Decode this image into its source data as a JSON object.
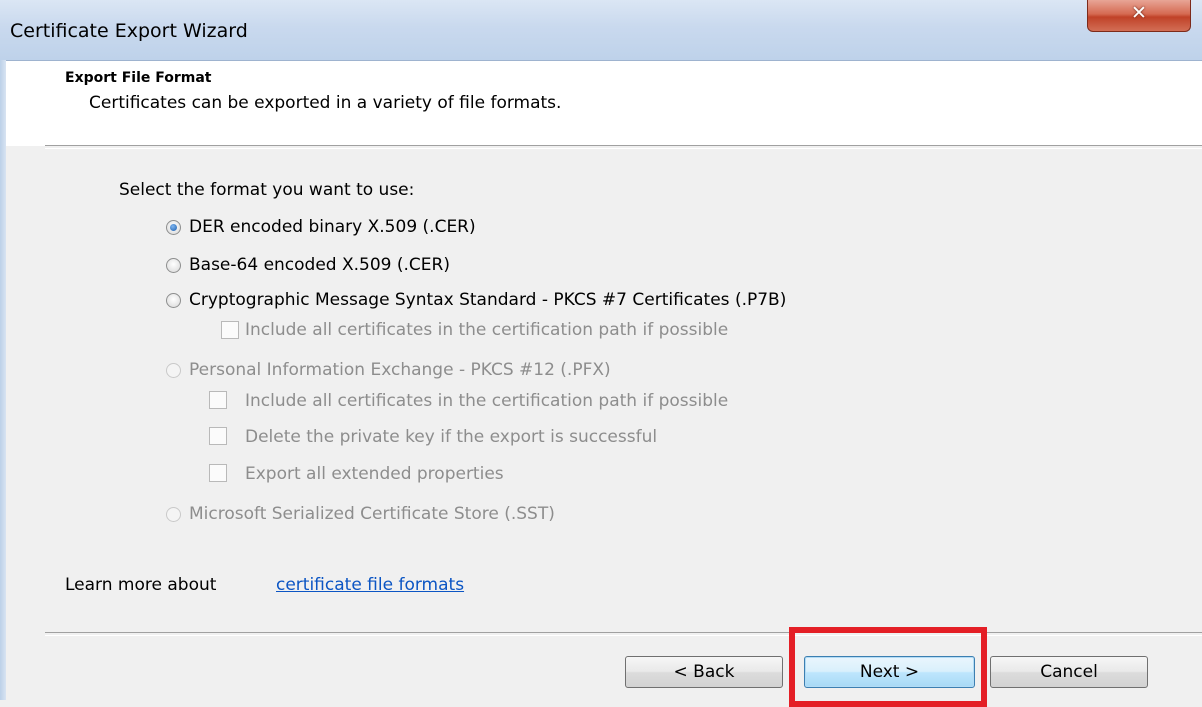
{
  "window": {
    "title": "Certificate Export Wizard",
    "close_label": "✕"
  },
  "header": {
    "title": "Export File Format",
    "description": "Certificates can be exported in a variety of file formats."
  },
  "prompt": "Select the format you want to use:",
  "options": [
    {
      "label": "DER encoded binary X.509 (.CER)",
      "checked": true,
      "enabled": true
    },
    {
      "label": "Base-64 encoded X.509 (.CER)",
      "checked": false,
      "enabled": true
    },
    {
      "label": "Cryptographic Message Syntax Standard - PKCS #7 Certificates (.P7B)",
      "checked": false,
      "enabled": true
    },
    {
      "label": "Personal Information Exchange - PKCS #12 (.PFX)",
      "checked": false,
      "enabled": false
    },
    {
      "label": "Microsoft Serialized Certificate Store (.SST)",
      "checked": false,
      "enabled": false
    }
  ],
  "pkcs7_checkboxes": [
    {
      "label": "Include all certificates in the certification path if possible",
      "checked": false,
      "enabled": false
    }
  ],
  "pfx_checkboxes": [
    {
      "label": "Include all certificates in the certification path if possible",
      "checked": false,
      "enabled": false
    },
    {
      "label": "Delete the private key if the export is successful",
      "checked": false,
      "enabled": false
    },
    {
      "label": "Export all extended properties",
      "checked": false,
      "enabled": false
    }
  ],
  "learn_more": {
    "prefix": "Learn more about ",
    "link": "certificate file formats"
  },
  "buttons": {
    "back": "< Back",
    "next": "Next >",
    "cancel": "Cancel"
  },
  "annotation": {
    "highlight_color": "#e41f26",
    "highlight_target": "next-button"
  }
}
